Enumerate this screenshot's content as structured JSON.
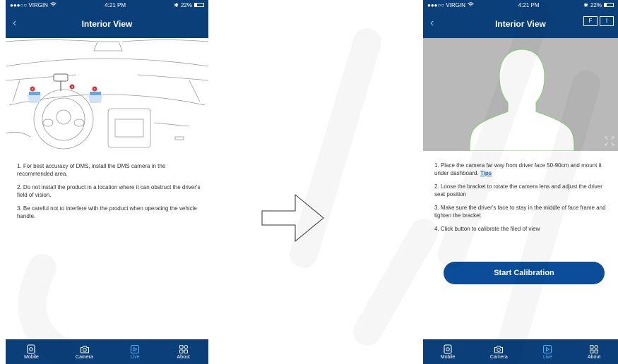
{
  "left_screen": {
    "status": {
      "carrier": "●●●○○ VIRGIN",
      "time": "4:21 PM",
      "battery_text": "22%",
      "battery_level": 0.22
    },
    "title": "Interior View",
    "back_icon": "chevron-left-icon",
    "instructions": [
      "1. For best accuracy of DMS, install the DMS camera in the recommended area.",
      "2. Do not install the product in a location where it can obstruct the driver's field of vision.",
      "3. Be careful not to interfere with the product when operating the vehicle handle."
    ],
    "tabs": [
      {
        "label": "Mobile",
        "icon": "mobile-icon",
        "active": false
      },
      {
        "label": "Camera",
        "icon": "camera-icon",
        "active": false
      },
      {
        "label": "Live",
        "icon": "live-play-icon",
        "active": true
      },
      {
        "label": "About",
        "icon": "grid-about-icon",
        "active": false
      }
    ],
    "illustration_markers": [
      "1",
      "2",
      "3"
    ]
  },
  "right_screen": {
    "status": {
      "carrier": "●●●○○ VIRGIN",
      "time": "4:21 PM",
      "battery_text": "22%",
      "battery_level": 0.22
    },
    "title": "Interior View",
    "toggle": {
      "f_label": "F",
      "i_label": "I"
    },
    "instructions": [
      {
        "text": "1.  Place the camera far way from driver face 50-90cm and mount it under dashboard.",
        "link": "Tips"
      },
      {
        "text": "2. Loose the bracket to rotate the camera lens and adjust the driver seat position"
      },
      {
        "text": "3. Make sure the driver's face to stay in the middle of face frame and tighten the bracket"
      },
      {
        "text": "4. Click button to calibrate the filed of view"
      }
    ],
    "start_button_label": "Start Calibration",
    "tabs": [
      {
        "label": "Mobile",
        "icon": "mobile-icon",
        "active": false
      },
      {
        "label": "Camera",
        "icon": "camera-icon",
        "active": false
      },
      {
        "label": "Live",
        "icon": "live-play-icon",
        "active": true
      },
      {
        "label": "About",
        "icon": "grid-about-icon",
        "active": false
      }
    ]
  },
  "colors": {
    "nav_blue": "#0b3f7a",
    "button_blue": "#0b4d98",
    "active_tab": "#4fb4ff",
    "silhouette_outline": "#7ed36b",
    "marker_red": "#d9323a"
  }
}
